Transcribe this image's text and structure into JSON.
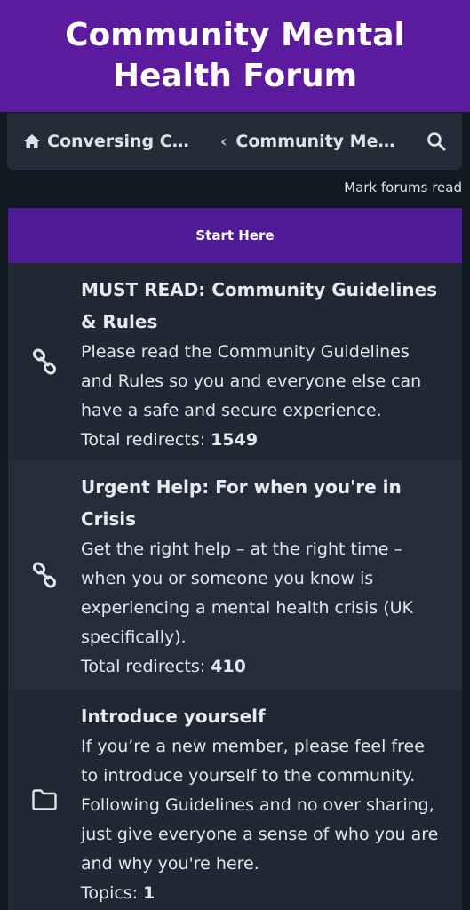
{
  "banner": {
    "title": "Community Mental Health Forum"
  },
  "navbar": {
    "home_label": "Conversing Ca…",
    "home_icon": "home-icon",
    "separator_icon": "chevron-left-icon",
    "current_label": "Community Ment…",
    "search_icon": "search-icon"
  },
  "actions": {
    "mark_forums_read": "Mark forums read"
  },
  "section": {
    "title": "Start Here"
  },
  "forums": [
    {
      "icon": "link-icon",
      "title": "MUST READ: Community Guidelines & Rules",
      "description": "Please read the Community Guidelines and Rules so you and everyone else can have a safe and secure experience.",
      "stat_label": "Total redirects:",
      "stat_value": "1549"
    },
    {
      "icon": "link-icon",
      "title": "Urgent Help: For when you're in Crisis",
      "description": "Get the right help – at the right time – when you or someone you know is experiencing a mental health crisis (UK specifically).",
      "stat_label": "Total redirects:",
      "stat_value": "410"
    },
    {
      "icon": "folder-icon",
      "title": "Introduce yourself",
      "description": "If you’re a new member, please feel free to introduce yourself to the community. Following Guidelines and no over sharing, just give everyone a sense of who you are and why you're here.",
      "stat_label": "Topics:",
      "stat_value": "1"
    }
  ],
  "colors": {
    "brand_purple": "#5c1a9e",
    "section_purple": "#4e1a95",
    "background": "#101820",
    "row_dark": "#1f2833",
    "row_light": "#242e3a"
  }
}
